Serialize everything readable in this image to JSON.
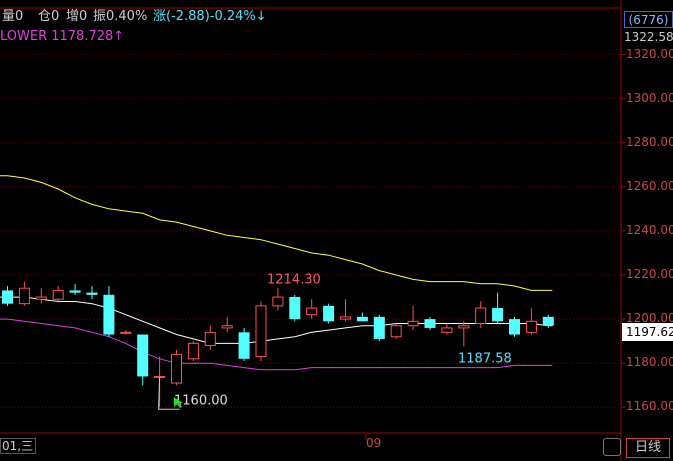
{
  "topbar": {
    "volume": "量0",
    "open_interest": "仓0",
    "increase": "增0",
    "amplitude": "振0.40%",
    "change": "涨(-2.88)-0.24%↓"
  },
  "indicator": {
    "lower_label": "LOWER 1178.728↑"
  },
  "side": {
    "code": "(6776)",
    "prev_close": "1322.58",
    "current_price": "1197.62"
  },
  "bottom": {
    "left_date": "01,三",
    "mid_date": "09",
    "period_button": "日线"
  },
  "colors": {
    "up": "#ff5050",
    "down": "#54ffff",
    "grid": "#7a0000",
    "ma_short": "#ffffff",
    "ma_long": "#ffff40",
    "lower": "#e040e0"
  },
  "chart_data": {
    "type": "candlestick",
    "y_axis": {
      "labels": [
        "1320.00",
        "1300.00",
        "1280.00",
        "1260.00",
        "1240.00",
        "1220.00",
        "1200.00",
        "1180.00",
        "1160.00"
      ],
      "range": [
        1155,
        1332
      ]
    },
    "annotations": [
      {
        "text": "1214.30",
        "value": 1214.3
      },
      {
        "text": "1187.58",
        "value": 1187.58
      },
      {
        "text": "1160.00",
        "value": 1160.0
      }
    ],
    "candles": [
      {
        "o": 1213,
        "c": 1207,
        "h": 1215,
        "l": 1206
      },
      {
        "o": 1207,
        "c": 1214,
        "h": 1217,
        "l": 1206
      },
      {
        "o": 1209,
        "c": 1210,
        "h": 1214,
        "l": 1207
      },
      {
        "o": 1209,
        "c": 1213,
        "h": 1215,
        "l": 1208
      },
      {
        "o": 1213,
        "c": 1212,
        "h": 1216,
        "l": 1211
      },
      {
        "o": 1212,
        "c": 1211,
        "h": 1215,
        "l": 1209
      },
      {
        "o": 1211,
        "c": 1193,
        "h": 1215,
        "l": 1192
      },
      {
        "o": 1194,
        "c": 1194,
        "h": 1195,
        "l": 1193
      },
      {
        "o": 1193,
        "c": 1174,
        "h": 1193,
        "l": 1170
      },
      {
        "o": 1174,
        "c": 1174,
        "h": 1183,
        "l": 1160
      },
      {
        "o": 1171,
        "c": 1184,
        "h": 1186,
        "l": 1170
      },
      {
        "o": 1182,
        "c": 1189,
        "h": 1190,
        "l": 1181
      },
      {
        "o": 1188,
        "c": 1194,
        "h": 1197,
        "l": 1186
      },
      {
        "o": 1196,
        "c": 1197,
        "h": 1201,
        "l": 1194
      },
      {
        "o": 1194,
        "c": 1182,
        "h": 1196,
        "l": 1181
      },
      {
        "o": 1183,
        "c": 1206,
        "h": 1208,
        "l": 1181
      },
      {
        "o": 1206,
        "c": 1210,
        "h": 1214.3,
        "l": 1204
      },
      {
        "o": 1210,
        "c": 1200,
        "h": 1211,
        "l": 1199
      },
      {
        "o": 1202,
        "c": 1205,
        "h": 1209,
        "l": 1200
      },
      {
        "o": 1206,
        "c": 1199,
        "h": 1207,
        "l": 1198
      },
      {
        "o": 1200,
        "c": 1201,
        "h": 1209,
        "l": 1199
      },
      {
        "o": 1201,
        "c": 1199,
        "h": 1203,
        "l": 1199
      },
      {
        "o": 1201,
        "c": 1191,
        "h": 1202,
        "l": 1190
      },
      {
        "o": 1192,
        "c": 1197,
        "h": 1198,
        "l": 1191
      },
      {
        "o": 1197,
        "c": 1199,
        "h": 1206,
        "l": 1195
      },
      {
        "o": 1200,
        "c": 1196,
        "h": 1201,
        "l": 1195
      },
      {
        "o": 1194,
        "c": 1196,
        "h": 1198,
        "l": 1193
      },
      {
        "o": 1196,
        "c": 1197,
        "h": 1199,
        "l": 1187.58
      },
      {
        "o": 1198,
        "c": 1205,
        "h": 1208,
        "l": 1196
      },
      {
        "o": 1205,
        "c": 1199,
        "h": 1212,
        "l": 1198
      },
      {
        "o": 1200,
        "c": 1193,
        "h": 1201,
        "l": 1192
      },
      {
        "o": 1194,
        "c": 1199,
        "h": 1205,
        "l": 1193
      },
      {
        "o": 1201,
        "c": 1197,
        "h": 1202,
        "l": 1196
      }
    ],
    "ma_short": [
      1210,
      1210,
      1209,
      1208,
      1208,
      1207,
      1205,
      1202,
      1199,
      1196,
      1193,
      1191,
      1189,
      1189,
      1189,
      1190,
      1191,
      1192,
      1194,
      1195,
      1196,
      1197,
      1197,
      1198,
      1198,
      1198,
      1198,
      1198,
      1198,
      1198,
      1198,
      1198,
      1197
    ],
    "ma_long": [
      1265,
      1264,
      1262,
      1259,
      1255,
      1252,
      1250,
      1249,
      1248,
      1245,
      1244,
      1242,
      1240,
      1238,
      1237,
      1236,
      1234,
      1232,
      1230,
      1229,
      1227,
      1225,
      1222,
      1220,
      1218,
      1217,
      1217,
      1217,
      1216,
      1216,
      1215,
      1213,
      1213
    ],
    "lower": [
      1200,
      1199,
      1198,
      1197,
      1196,
      1194,
      1192,
      1189,
      1185,
      1182,
      1180,
      1180,
      1180,
      1179,
      1178,
      1177,
      1177,
      1177,
      1178,
      1178,
      1178,
      1178,
      1178,
      1178,
      1178,
      1178,
      1178,
      1178,
      1178,
      1178,
      1179,
      1179,
      1179
    ]
  }
}
